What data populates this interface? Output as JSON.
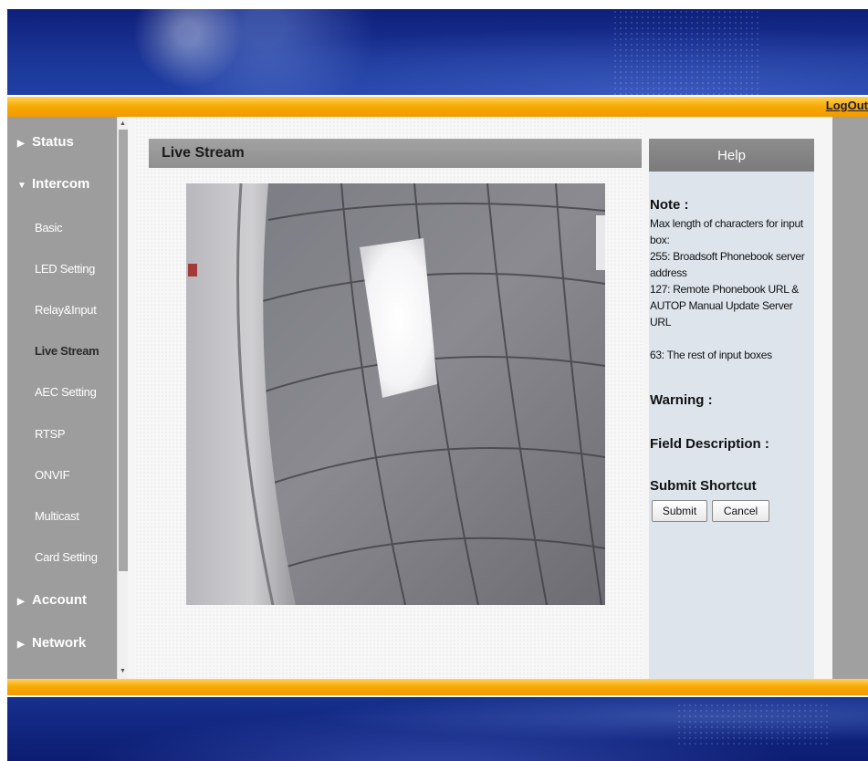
{
  "header": {
    "logout_label": "LogOut"
  },
  "sidebar": {
    "items": [
      {
        "label": "Status",
        "type": "category",
        "expanded": false
      },
      {
        "label": "Intercom",
        "type": "category",
        "expanded": true
      },
      {
        "label": "Basic",
        "type": "sub"
      },
      {
        "label": "LED Setting",
        "type": "sub"
      },
      {
        "label": "Relay&Input",
        "type": "sub"
      },
      {
        "label": "Live Stream",
        "type": "sub",
        "active": true
      },
      {
        "label": "AEC Setting",
        "type": "sub"
      },
      {
        "label": "RTSP",
        "type": "sub"
      },
      {
        "label": "ONVIF",
        "type": "sub"
      },
      {
        "label": "Multicast",
        "type": "sub"
      },
      {
        "label": "Card Setting",
        "type": "sub"
      },
      {
        "label": "Account",
        "type": "category",
        "expanded": false
      },
      {
        "label": "Network",
        "type": "category",
        "expanded": false
      }
    ]
  },
  "main": {
    "section_title": "Live Stream",
    "video_alt": "live-camera-feed"
  },
  "help": {
    "title": "Help",
    "note_title": "Note :",
    "note_lines": [
      "Max length of characters for input box:",
      "255: Broadsoft Phonebook server address",
      "127: Remote Phonebook URL & AUTOP Manual Update Server URL",
      "63: The rest of input boxes"
    ],
    "warning_title": "Warning :",
    "field_description_title": "Field Description :",
    "submit_shortcut_title": "Submit Shortcut",
    "submit_label": "Submit",
    "cancel_label": "Cancel"
  },
  "icons": {
    "collapsed_arrow": "triangle-right-icon",
    "expanded_arrow": "triangle-down-icon",
    "scroll_up": "scroll-up-arrow-icon",
    "scroll_down": "scroll-down-arrow-icon"
  },
  "colors": {
    "banner_blue": "#1a3596",
    "accent_orange": "#f7a800",
    "sidebar_gray": "#9d9d9d",
    "help_panel": "#dde4ec"
  }
}
